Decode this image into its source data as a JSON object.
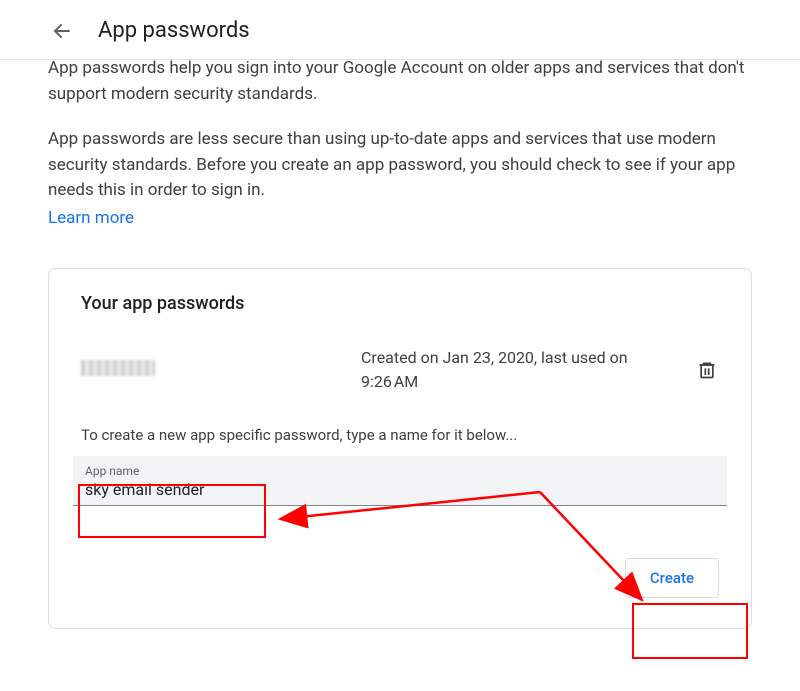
{
  "header": {
    "title": "App passwords"
  },
  "intro": {
    "p1": "App passwords help you sign into your Google Account on older apps and services that don't support modern security standards.",
    "p2": "App passwords are less secure than using up-to-date apps and services that use modern security standards. Before you create an app password, you should check to see if your app needs this in order to sign in.",
    "learn_more": "Learn more"
  },
  "card": {
    "title": "Your app passwords",
    "existing": {
      "created_line": "Created on Jan 23, 2020, last used on 9:26 AM"
    },
    "instruction": "To create a new app specific password, type a name for it below...",
    "input": {
      "label": "App name",
      "value": "sky email sender"
    },
    "create_label": "Create"
  }
}
